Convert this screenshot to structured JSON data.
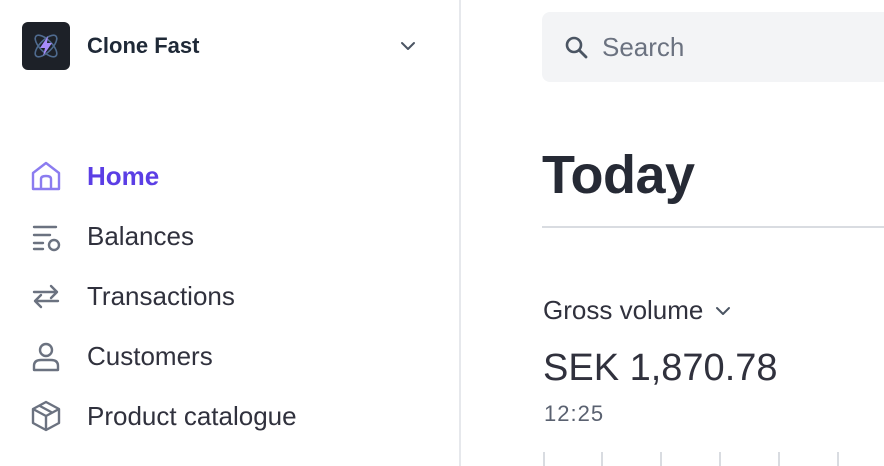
{
  "account": {
    "name": "Clone Fast",
    "logo_icon": "lightning-atom-icon"
  },
  "sidebar": {
    "items": [
      {
        "label": "Home",
        "icon": "home-icon",
        "active": true
      },
      {
        "label": "Balances",
        "icon": "balances-icon",
        "active": false
      },
      {
        "label": "Transactions",
        "icon": "transactions-icon",
        "active": false
      },
      {
        "label": "Customers",
        "icon": "customers-icon",
        "active": false
      },
      {
        "label": "Product catalogue",
        "icon": "product-box-icon",
        "active": false
      }
    ]
  },
  "search": {
    "placeholder": "Search"
  },
  "main": {
    "title": "Today",
    "metric": {
      "label": "Gross volume",
      "value": "SEK 1,870.78",
      "time": "12:25"
    }
  },
  "colors": {
    "accent": "#5b3ee5",
    "logo_bg": "#1d2128",
    "text": "#30313d"
  }
}
